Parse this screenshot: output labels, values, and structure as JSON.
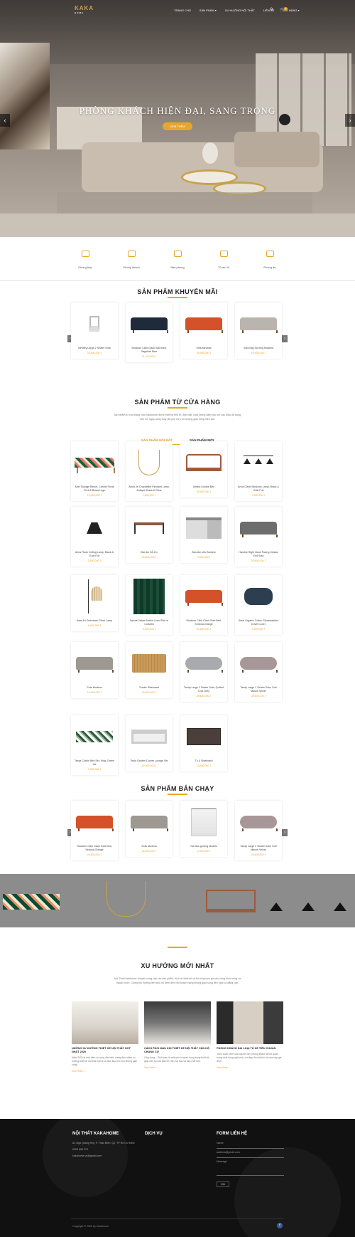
{
  "header": {
    "logo": "KAKA",
    "logo_sub": "HOME",
    "nav": [
      "TRANG CHỦ",
      "SẢN PHẨM ▾",
      "XU HƯỚNG NỘI THẤT",
      "LIÊN HỆ",
      "GIỎ HÀNG ▾"
    ],
    "cart_count": "0"
  },
  "hero": {
    "title": "PHÒNG KHÁCH HIỆN ĐẠI, SANG TRỌNG",
    "button": "XEM THÊM",
    "prev_arrow": "‹",
    "next_arrow": "›"
  },
  "categories": [
    "Phòng bếp",
    "Phòng khách",
    "Bàn phòng",
    "Tủ áo, tủ",
    "Phòng ăn"
  ],
  "promo": {
    "title": "SẢN PHẨM KHUYẾN MÃI",
    "items": [
      {
        "name": "Bentley Large 2 Seater Sofa",
        "price": "33,800,000 ₫"
      },
      {
        "name": "Stockton Click Clack Sofa Bed, Sapphire Blue",
        "price": "31,200,000 ₫"
      },
      {
        "name": "Sofa Mirande",
        "price": "18,900,000 ₫"
      },
      {
        "name": "Sofa Bay Giường Modena",
        "price": "18,900,000 ₫"
      }
    ]
  },
  "store": {
    "title": "SẢN PHẨM TỪ CỬA HÀNG",
    "desc": "Sản phẩm từ cửa hàng của Kakahome được thiết kế tinh tế, đẹp mắt, chất lượng đảm bảo với các mẫu đa dạng, tiện ích ngày càng thay đổi phù hợp với không gian sống hiện đại.",
    "tab_active": "SẢN PHẨM NỔI BẬT",
    "tab_inactive": "SẢN PHẨM MỚI",
    "items": [
      {
        "name": "Abel Storage Bench, Carolin Floral Print & Brass Legs",
        "price": "13,300,000 ₫"
      },
      {
        "name": "Alixia 4rt Chandelier Pendant Lamp, Antique Brass & Clear",
        "price": "7,800,000 ₫"
      },
      {
        "name": "Amara Double Bed",
        "price": "28,900,000 ₫"
      },
      {
        "name": "Anna Clear Windows Lamp, Black & Gold Foil",
        "price": "3,900,000 ₫"
      },
      {
        "name": "Aries Flush Ceiling Lamp, Black & Gold Foil",
        "price": "3,800,000 ₫"
      },
      {
        "name": "Bàn ăn Gỗ 2m",
        "price": "16,800,000 ₫"
      },
      {
        "name": "Bàn làm việc Modelo",
        "price": "9,600,000 ₫"
      },
      {
        "name": "Hamble Right Hand Facing Chaise End Sofa",
        "price": "26,800,000 ₫"
      },
      {
        "name": "Isaia 4rt Overreach Pleck Lamp",
        "price": "4,400,000 ₫"
      },
      {
        "name": "Sylvas Velvet Button Lined Pair of Curtains",
        "price": "3,200,000 ₫"
      },
      {
        "name": "Stockton Click Clack Sofa Bed, Sedona Orange",
        "price": "24,600,000 ₫"
      },
      {
        "name": "Serai Organic Cotton Stonewashed Duvet Cover",
        "price": "4,900,000 ₫"
      },
      {
        "name": "Sofa Modena",
        "price": "18,900,000 ₫"
      },
      {
        "name": "Tombo Sideboard",
        "price": "16,800,000 ₫"
      },
      {
        "name": "Tandy Large 2 Seater Sofa, Quilted Cool Grey",
        "price": "28,600,000 ₫"
      },
      {
        "name": "Tandy Large 2 Seater Sofa, Soft Mauve Velvet",
        "price": "28,600,000 ₫"
      },
      {
        "name": "Tessa Cotton Bed Set, King, Green Ink",
        "price": "3,900,000 ₫"
      },
      {
        "name": "Tesla Garden Corner Lounge Set",
        "price": "42,900,000 ₫"
      },
      {
        "name": "Tủ & Sideboard",
        "price": "18,400,000 ₫"
      }
    ]
  },
  "bestseller": {
    "title": "SẢN PHẨM BÁN CHẠY",
    "items": [
      {
        "name": "Stockton Click Clack Sofa Bed, Sedona Orange",
        "price": "24,600,000 ₫"
      },
      {
        "name": "Sofa Modena",
        "price": "18,900,000 ₫"
      },
      {
        "name": "Tab đầu giường Modelo",
        "price": "2,900,000 ₫"
      },
      {
        "name": "Tandy Large 2 Seater Sofa, Soft Mauve Velvet",
        "price": "28,600,000 ₫"
      }
    ]
  },
  "blog": {
    "title": "XU HƯỚNG MỚI NHẤT",
    "desc": "Nội Thất Kakahome chuyên cung cấp các sản phẩm, dịch vụ thiết kế và thi công trọn gói các công trình trong và ngoài nước. Chúng tôi hướng đến tiêu chí đem đến cho khách hàng không gian sống tiện nghi và đẳng cấp.",
    "posts": [
      {
        "title": "NHỮNG XU HƯỚNG THIẾT KẾ NỘI THẤT HOT NHẤT 2020",
        "excerpt": "Năm 2020 là một năm vô cùng đặc biệt, mang đến nhiều xu hướng thiết kế nội thất mới lạ và độc đáo cho mọi không gian sống.",
        "more": "Xem thêm →"
      },
      {
        "title": "CÁCH PHỐI MÀU KHI THIẾT KẾ NỘI THẤT CĂN HỘ CHUNG CƯ",
        "excerpt": "Ứng dụng – Phối màu là một yếu tố quan trọng trong thiết kế, giúp căn hộ của bạn trở nên hài hòa và đẹp mắt hơn.",
        "more": "Xem thêm →"
      },
      {
        "title": "PHÒNG KHÁCH HAI LOẠI TỦ KẾ TIÊU CHUẨN",
        "excerpt": "Theo quan niệm của người Việt, phòng khách là nơi quan trọng nhất trong ngôi nhà, nơi tiếp đón khách và sum họp gia đình.",
        "more": "Xem thêm →"
      }
    ]
  },
  "footer": {
    "col1_title": "NỘI THẤT KAKAHOME",
    "address": "A1 Ngô Quang Huy, P. Thảo Điền, Q2, TP Hồ Chí Minh",
    "phone": "0909 654 270",
    "email": "kakahome.vn@gmail.com",
    "col2_title": "DỊCH VỤ",
    "col3_title": "FORM LIÊN HỆ",
    "form_name": "Name",
    "form_email": "address@gmail.com",
    "form_msg": "Message",
    "form_send": "Gửi",
    "copyright": "Copyright © 2020 by Kakahome",
    "fb": "f"
  }
}
